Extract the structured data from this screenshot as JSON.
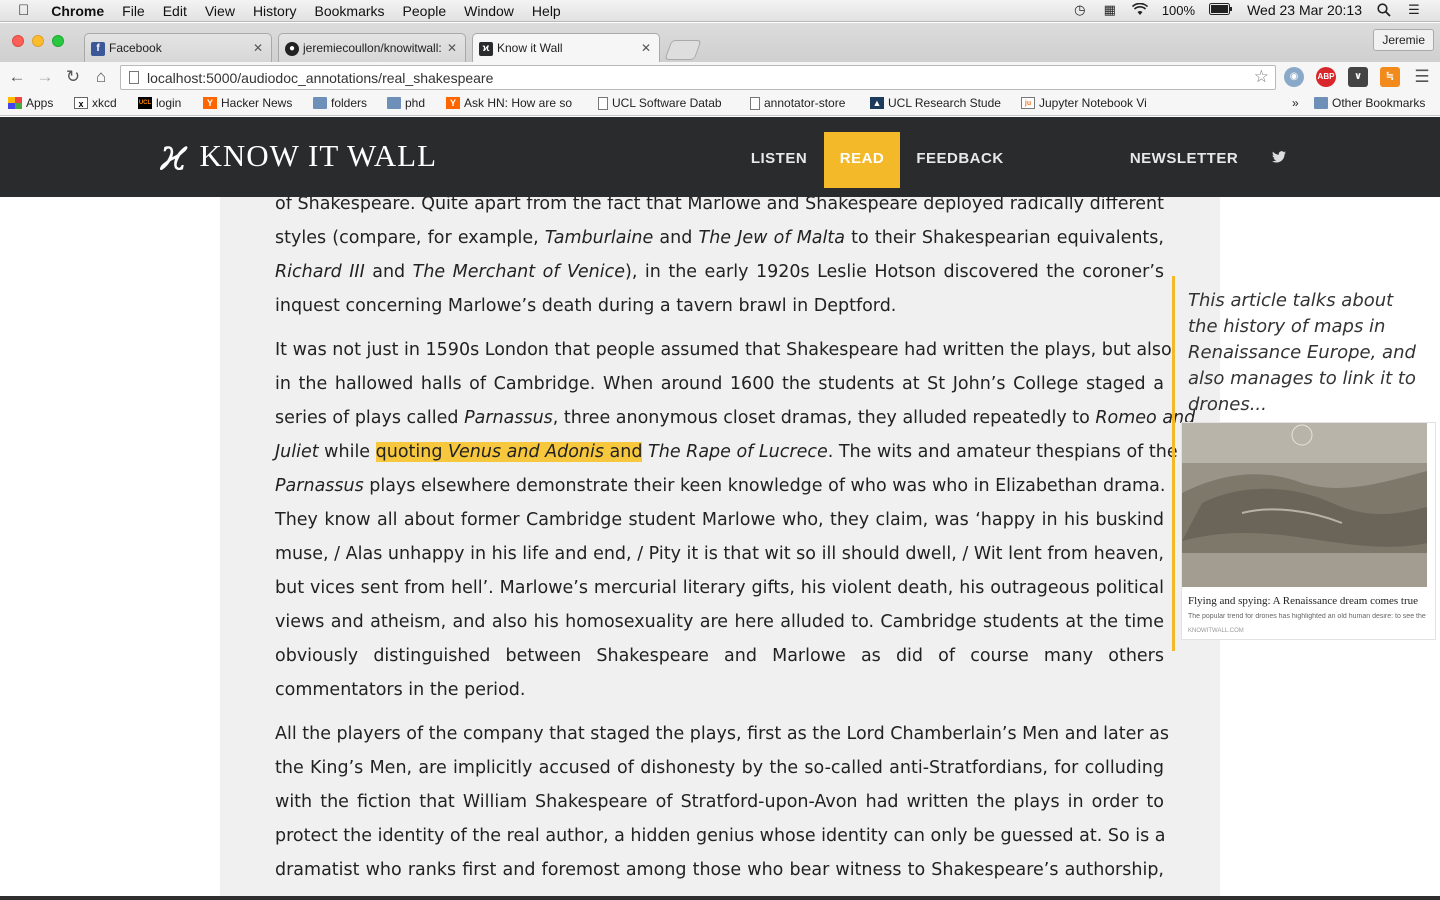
{
  "menubar": {
    "apple": "",
    "app": "Chrome",
    "menus": [
      "File",
      "Edit",
      "View",
      "History",
      "Bookmarks",
      "People",
      "Window",
      "Help"
    ],
    "battery": "100%",
    "datetime": "Wed 23 Mar  20:13"
  },
  "tabs": [
    {
      "title": "Facebook",
      "icon": "facebook-icon"
    },
    {
      "title": "jeremiecoullon/knowitwall:",
      "icon": "github-icon"
    },
    {
      "title": "Know it Wall",
      "icon": "knowitwall-icon"
    }
  ],
  "profile": "Jeremie",
  "address": "localhost:5000/audiodoc_annotations/real_shakespeare",
  "bookmarks": [
    {
      "label": "Apps",
      "icon": "apps-grid-icon"
    },
    {
      "label": "xkcd",
      "icon": "xkcd-icon"
    },
    {
      "label": "login",
      "icon": "ucl-icon"
    },
    {
      "label": "Hacker News",
      "icon": "hacker-news-icon"
    },
    {
      "label": "folders",
      "icon": "folder-icon"
    },
    {
      "label": "phd",
      "icon": "folder-icon"
    },
    {
      "label": "Ask HN: How are so",
      "icon": "hacker-news-icon"
    },
    {
      "label": "UCL Software Datab",
      "icon": "page-icon"
    },
    {
      "label": "annotator-store",
      "icon": "page-icon"
    },
    {
      "label": "UCL Research Stude",
      "icon": "ucl-icon"
    },
    {
      "label": "Jupyter Notebook Vi",
      "icon": "jupyter-icon"
    }
  ],
  "bookmarks_more": "»",
  "other_bookmarks": "Other Bookmarks",
  "site": {
    "logo_mark": "ϰ",
    "logo_text": "KNOW IT WALL",
    "nav": [
      "LISTEN",
      "READ",
      "FEEDBACK",
      "NEWSLETTER"
    ],
    "active_nav": "READ",
    "accent": "#f3b929",
    "header_bg": "#2a2b2d"
  },
  "article": {
    "p1": [
      "of Shakespeare. Quite apart from the fact that Marlowe and Shakespeare deployed radically different",
      "styles (compare, for example, ",
      "Tamburlaine",
      " and ",
      "The Jew of Malta",
      " to their Shakespearian equivalents,",
      "Richard III",
      " and ",
      "The Merchant of Venice",
      "), in the early 1920s Leslie Hotson discovered the coroner’s",
      "inquest concerning Marlowe’s death during a tavern brawl in Deptford."
    ],
    "p2": [
      "It was not just in 1590s London that people assumed that Shakespeare had written the plays, but also",
      "in the hallowed halls of Cambridge. When around 1600 the students at St John’s College staged a",
      "series of plays called ",
      "Parnassus",
      ", three anonymous closet dramas, they alluded repeatedly to ",
      "Romeo and",
      "Juliet",
      " while ",
      "quoting ",
      "Venus and Adonis",
      " and",
      " ",
      "The Rape of Lucrece",
      ". The wits and amateur thespians of the",
      "Parnassus",
      " plays elsewhere demonstrate their keen knowledge of who was who in Elizabethan drama.",
      "They know all about former Cambridge student Marlowe who, they claim, was ‘happy in his buskind",
      "muse, / Alas unhappy in his life and end, / Pity it is that wit so ill should dwell, / Wit lent from heaven,",
      "but vices sent from hell’. Marlowe’s mercurial literary gifts, his violent death, his outrageous political",
      "views and atheism, and also his homosexuality are here alluded to. Cambridge students at the time",
      "obviously distinguished between Shakespeare and Marlowe as did of course many others",
      "commentators in the period."
    ],
    "p3": [
      "All the players of the company that staged the plays, first as the Lord Chamberlain’s Men and later as",
      "the King’s Men, are implicitly accused of dishonesty by the so-called anti-Stratfordians, for colluding",
      "with the fiction that William Shakespeare of Stratford-upon-Avon had written the plays in order to",
      "protect the identity of the real author, a hidden genius whose identity can only be guessed at. So is a",
      "dramatist who ranks first and foremost among those who bear witness to Shakespeare’s authorship,"
    ]
  },
  "annotation": {
    "text": "This article talks about the history of maps in Renaissance Europe, and also manages to link it to drones...",
    "card_title": "Flying and spying: A Renaissance dream comes true",
    "card_desc": "The popular trend for drones has highlighted an old human desire: to see the world fro...",
    "card_source": "KNOWITWALL.COM"
  }
}
